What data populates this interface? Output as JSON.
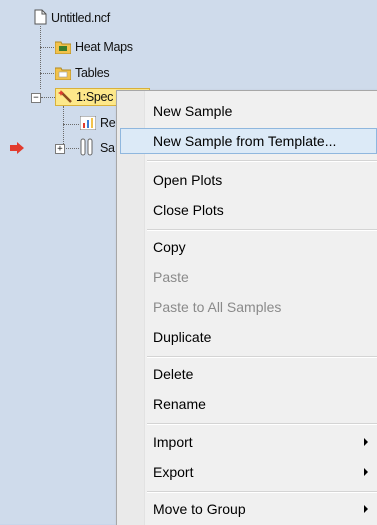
{
  "tree": {
    "root": "Untitled.ncf",
    "heat_maps": "Heat Maps",
    "tables": "Tables",
    "spec": "1:Spec",
    "child1": "Re",
    "child2": "Sa"
  },
  "menu": {
    "new_sample": "New Sample",
    "new_from_template": "New Sample from Template...",
    "open_plots": "Open Plots",
    "close_plots": "Close Plots",
    "copy": "Copy",
    "paste": "Paste",
    "paste_all": "Paste to All Samples",
    "duplicate": "Duplicate",
    "delete": "Delete",
    "rename": "Rename",
    "import": "Import",
    "export": "Export",
    "move_to_group": "Move to Group"
  },
  "colors": {
    "accent_red": "#e23b2e",
    "folder": "#f2c24b",
    "highlight": "#fde88a"
  }
}
